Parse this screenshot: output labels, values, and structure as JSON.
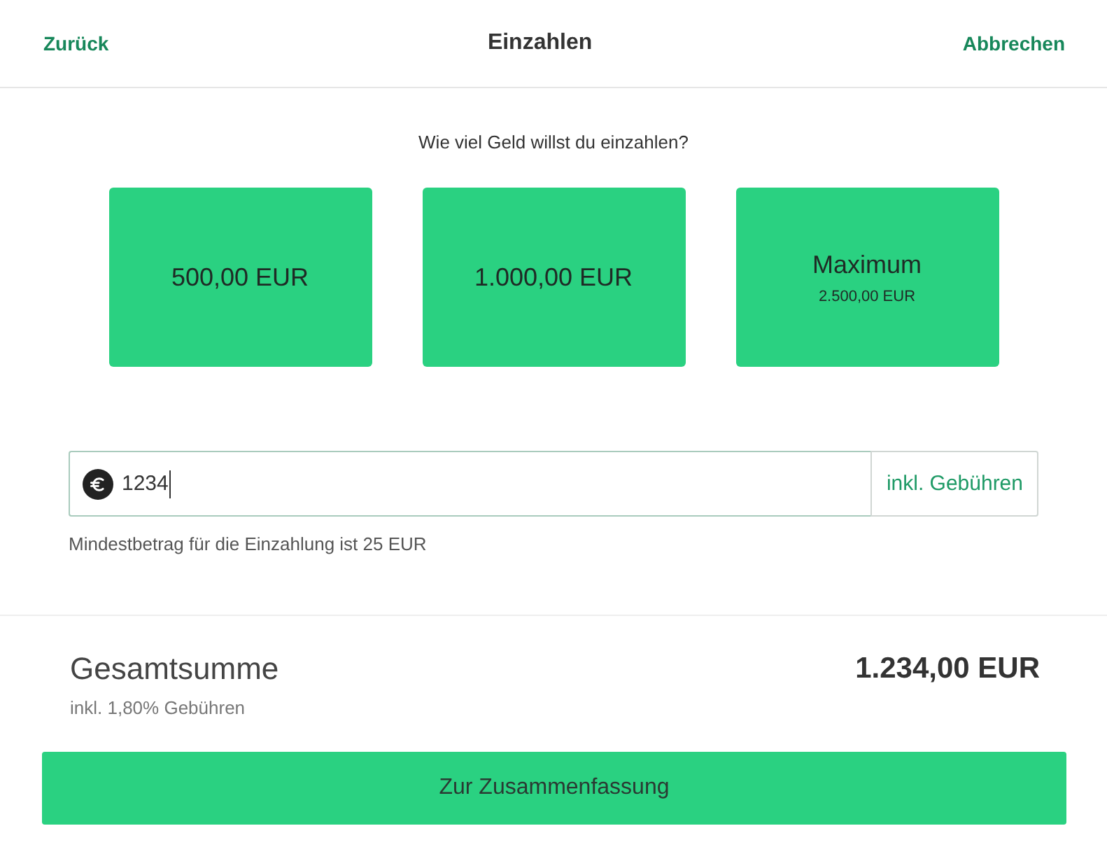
{
  "header": {
    "back": "Zurück",
    "title": "Einzahlen",
    "cancel": "Abbrechen"
  },
  "question": "Wie viel Geld willst du einzahlen?",
  "choices": [
    {
      "label": "500,00 EUR",
      "selected": false
    },
    {
      "label": "1.000,00 EUR",
      "selected": false
    },
    {
      "label": "Maximum",
      "sublabel": "2.500,00 EUR",
      "selected": false
    }
  ],
  "amount_field": {
    "value": "1234",
    "focused": true,
    "addon": "inkl. Gebühren"
  },
  "hint": "Mindestbetrag für die Einzahlung ist 25 EUR",
  "total": {
    "label": "Gesamtsumme",
    "amount": "1.234,00 EUR",
    "note": "inkl. 1,80% Gebühren"
  },
  "submit_button": "Zur Zusammenfassung"
}
